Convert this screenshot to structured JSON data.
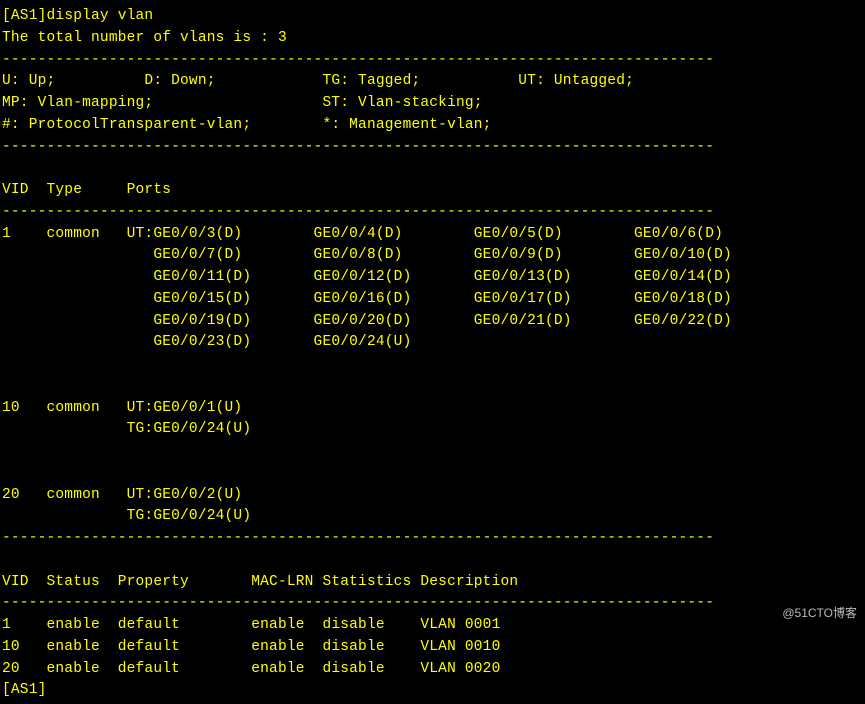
{
  "prompt_device": "[AS1]",
  "command": "display vlan",
  "summary_line_prefix": "The total number of vlans is : ",
  "vlan_total": 3,
  "legend": {
    "U": "Up;",
    "D": "Down;",
    "TG": "Tagged;",
    "UT": "Untagged;",
    "MP": "Vlan-mapping;",
    "ST": "Vlan-stacking;",
    "HASH": "ProtocolTransparent-vlan;",
    "STAR": "Management-vlan;"
  },
  "headers_ports": {
    "vid": "VID",
    "type": "Type",
    "ports": "Ports"
  },
  "vlans": [
    {
      "vid": "1",
      "type": "common",
      "port_groups": [
        {
          "tag": "UT:",
          "ports": [
            "GE0/0/3(D)",
            "GE0/0/4(D)",
            "GE0/0/5(D)",
            "GE0/0/6(D)"
          ]
        },
        {
          "tag": "",
          "ports": [
            "GE0/0/7(D)",
            "GE0/0/8(D)",
            "GE0/0/9(D)",
            "GE0/0/10(D)"
          ]
        },
        {
          "tag": "",
          "ports": [
            "GE0/0/11(D)",
            "GE0/0/12(D)",
            "GE0/0/13(D)",
            "GE0/0/14(D)"
          ]
        },
        {
          "tag": "",
          "ports": [
            "GE0/0/15(D)",
            "GE0/0/16(D)",
            "GE0/0/17(D)",
            "GE0/0/18(D)"
          ]
        },
        {
          "tag": "",
          "ports": [
            "GE0/0/19(D)",
            "GE0/0/20(D)",
            "GE0/0/21(D)",
            "GE0/0/22(D)"
          ]
        },
        {
          "tag": "",
          "ports": [
            "GE0/0/23(D)",
            "GE0/0/24(U)"
          ]
        }
      ]
    },
    {
      "vid": "10",
      "type": "common",
      "port_groups": [
        {
          "tag": "UT:",
          "ports": [
            "GE0/0/1(U)"
          ]
        },
        {
          "tag": "TG:",
          "ports": [
            "GE0/0/24(U)"
          ]
        }
      ]
    },
    {
      "vid": "20",
      "type": "common",
      "port_groups": [
        {
          "tag": "UT:",
          "ports": [
            "GE0/0/2(U)"
          ]
        },
        {
          "tag": "TG:",
          "ports": [
            "GE0/0/24(U)"
          ]
        }
      ]
    }
  ],
  "headers_status": {
    "vid": "VID",
    "status": "Status",
    "property": "Property",
    "maclrn": "MAC-LRN",
    "statistics": "Statistics",
    "description": "Description"
  },
  "status_rows": [
    {
      "vid": "1",
      "status": "enable",
      "property": "default",
      "mac_lrn": "enable",
      "statistics": "disable",
      "description": "VLAN 0001"
    },
    {
      "vid": "10",
      "status": "enable",
      "property": "default",
      "mac_lrn": "enable",
      "statistics": "disable",
      "description": "VLAN 0010"
    },
    {
      "vid": "20",
      "status": "enable",
      "property": "default",
      "mac_lrn": "enable",
      "statistics": "disable",
      "description": "VLAN 0020"
    }
  ],
  "final_prompt": "[AS1]",
  "watermark": "@51CTO博客"
}
